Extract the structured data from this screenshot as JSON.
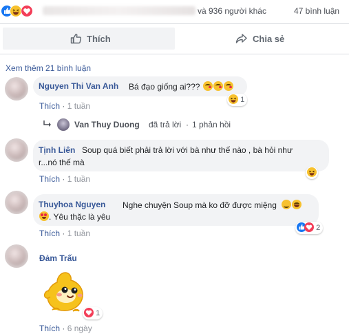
{
  "reactions_summary": {
    "names_suffix": "và 936 người khác",
    "comments_count": "47 bình luận"
  },
  "actions": {
    "like_label": "Thích",
    "share_label": "Chia sẻ"
  },
  "more_comments_label": "Xem thêm 21 bình luận",
  "comments": [
    {
      "author": "Nguyen Thi Van Anh",
      "text": "Bá đạo giống ai???",
      "like_label": "Thích",
      "time": "1 tuần",
      "reaction_count": "1",
      "reply": {
        "author": "Van Thuy Duong",
        "action": "đã trả lời",
        "separator": "·",
        "count": "1 phản hồi"
      }
    },
    {
      "author": "Tịnh Liên",
      "text_line1": "Soup quá biết phải trả lời với bà như thế nào , bà hỏi như",
      "text_line2": "r...nó thế mà",
      "like_label": "Thích",
      "time": "1 tuần"
    },
    {
      "author": "Thuyhoa Nguyen",
      "text_line1": "Nghe chuyện Soup mà ko đỡ được miệng",
      "text_line2": ". Yêu thặc là yêu",
      "like_label": "Thích",
      "time": "1 tuần",
      "reaction_count": "2"
    },
    {
      "author": "Đảm Trấu",
      "like_label": "Thích",
      "time": "6 ngày",
      "reaction_count": "1"
    }
  ],
  "dot": "·",
  "colors": {
    "link": "#385898",
    "like_blue": "#1877f2",
    "love_red": "#f33e58",
    "haha_yellow": "#f7c12e",
    "bubble_bg": "#f2f3f5"
  }
}
